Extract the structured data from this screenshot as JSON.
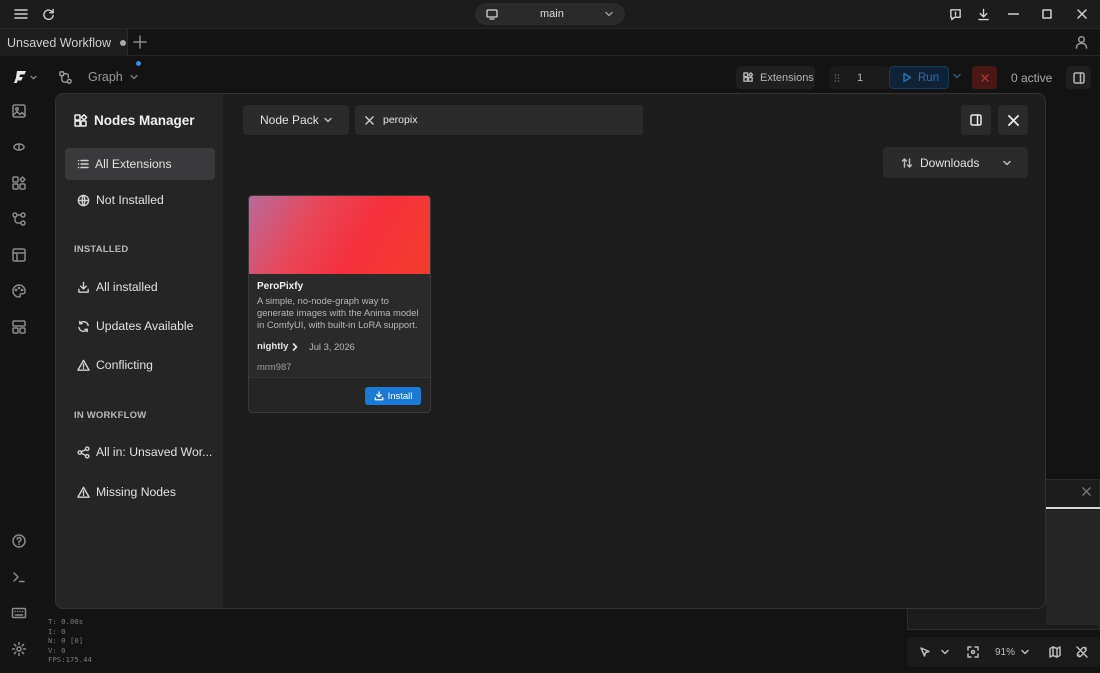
{
  "titlebar": {
    "branch_label": "main"
  },
  "tabs": [
    {
      "label": "Unsaved Workflow"
    }
  ],
  "canvas_toolbar": {
    "graph_label": "Graph",
    "extensions_label": "Extensions",
    "queue_count": "1",
    "run_label": "Run",
    "active_label": "0 active"
  },
  "modal": {
    "title": "Nodes Manager",
    "nav": {
      "all_extensions": "All Extensions",
      "not_installed": "Not Installed",
      "installed_heading": "INSTALLED",
      "all_installed": "All installed",
      "updates_available": "Updates Available",
      "conflicting": "Conflicting",
      "workflow_heading": "IN WORKFLOW",
      "all_in_workflow": "All in: Unsaved Wor...",
      "missing_nodes": "Missing Nodes"
    },
    "filter_select": "Node Pack",
    "search_value": "peropix",
    "sort_select": "Downloads",
    "results": [
      {
        "name": "PeroPixfy",
        "description": "A simple, no-node-graph way to generate images with the Anima model in ComfyUI, with built-in LoRA support.",
        "version": "nightly",
        "date": "Jul 3, 2026",
        "author": "mrm987",
        "action_label": "Install"
      }
    ]
  },
  "stats": {
    "line1": "T: 0.00s",
    "line2": "I: 0",
    "line3": "N: 0 [0]",
    "line4": "V: 0",
    "line5": "FPS:175.44"
  },
  "bottom_bar": {
    "zoom": "91%"
  },
  "colors": {
    "accent_blue": "#1a7ad6",
    "run_text": "#2b6fb0",
    "stop_red": "#6b1f1f"
  }
}
